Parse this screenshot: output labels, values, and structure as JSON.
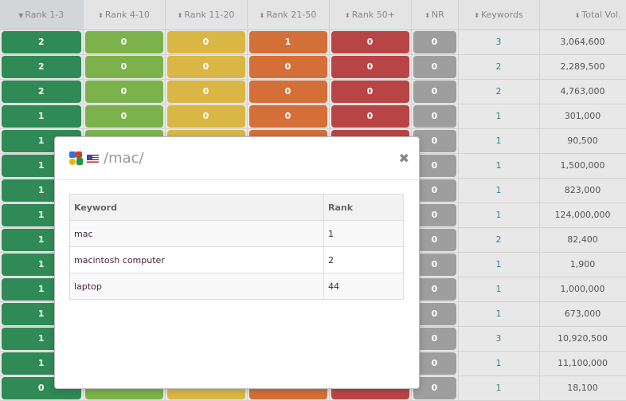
{
  "columns": [
    "Rank 1-3",
    "Rank 4-10",
    "Rank 11-20",
    "Rank 21-50",
    "Rank 50+",
    "NR",
    "Keywords",
    "Total Vol."
  ],
  "rows": [
    {
      "r1": "2",
      "r4": "0",
      "r11": "0",
      "r21": "1",
      "r50": "0",
      "nr": "0",
      "kw": "3",
      "vol": "3,064,600"
    },
    {
      "r1": "2",
      "r4": "0",
      "r11": "0",
      "r21": "0",
      "r50": "0",
      "nr": "0",
      "kw": "2",
      "vol": "2,289,500"
    },
    {
      "r1": "2",
      "r4": "0",
      "r11": "0",
      "r21": "0",
      "r50": "0",
      "nr": "0",
      "kw": "2",
      "vol": "4,763,000"
    },
    {
      "r1": "1",
      "r4": "0",
      "r11": "0",
      "r21": "0",
      "r50": "0",
      "nr": "0",
      "kw": "1",
      "vol": "301,000"
    },
    {
      "r1": "1",
      "nr": "0",
      "kw": "1",
      "vol": "90,500"
    },
    {
      "r1": "1",
      "nr": "0",
      "kw": "1",
      "vol": "1,500,000"
    },
    {
      "r1": "1",
      "nr": "0",
      "kw": "1",
      "vol": "823,000"
    },
    {
      "r1": "1",
      "nr": "0",
      "kw": "1",
      "vol": "124,000,000"
    },
    {
      "r1": "1",
      "nr": "0",
      "kw": "2",
      "vol": "82,400"
    },
    {
      "r1": "1",
      "nr": "0",
      "kw": "1",
      "vol": "1,900"
    },
    {
      "r1": "1",
      "nr": "0",
      "kw": "1",
      "vol": "1,000,000"
    },
    {
      "r1": "1",
      "nr": "0",
      "kw": "1",
      "vol": "673,000"
    },
    {
      "r1": "1",
      "nr": "0",
      "kw": "3",
      "vol": "10,920,500"
    },
    {
      "r1": "1",
      "nr": "0",
      "kw": "1",
      "vol": "11,100,000"
    },
    {
      "r1": "0",
      "nr": "0",
      "kw": "1",
      "vol": "18,100"
    }
  ],
  "modal": {
    "title": "/mac/",
    "headers": {
      "keyword": "Keyword",
      "rank": "Rank"
    },
    "rows": [
      {
        "keyword": "mac",
        "rank": "1"
      },
      {
        "keyword": "macintosh computer",
        "rank": "2"
      },
      {
        "keyword": "laptop",
        "rank": "44"
      }
    ],
    "icons": [
      "google-icon",
      "us-flag-icon",
      "close-icon"
    ]
  }
}
